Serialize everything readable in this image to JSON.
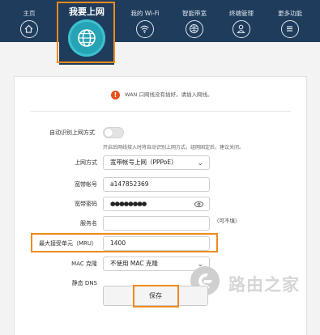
{
  "nav": {
    "items": [
      {
        "label": "主页",
        "icon": "home-icon"
      },
      {
        "label": "我的 Wi-Fi",
        "icon": "wifi-icon"
      },
      {
        "label": "智能带宽",
        "icon": "bandwidth-icon"
      },
      {
        "label": "终端管理",
        "icon": "user-icon"
      },
      {
        "label": "更多功能",
        "icon": "menu-icon"
      }
    ],
    "active": {
      "label": "我要上网",
      "icon": "globe-icon"
    }
  },
  "warning": {
    "text": "WAN 口网线没有插好，请插入网线。",
    "icon": "warning-icon"
  },
  "form": {
    "auto_detect_label": "自动识别上网方式",
    "auto_detect_hint": "开启后网线接入时将自动识别上网方式，组网固定后，建议关闭。",
    "wan_type_label": "上网方式",
    "wan_type_value": "宽带帐号上网（PPPoE）",
    "account_label": "宽带帐号",
    "account_value": "a147852369",
    "password_label": "宽带密码",
    "password_value": "●●●●●●●●",
    "service_label": "服务名",
    "service_value": "",
    "service_note": "（可不填）",
    "mru_label": "最大接受单元（MRU）",
    "mru_value": "1400",
    "mac_label": "MAC 克隆",
    "mac_value": "不使用 MAC 克隆",
    "dns_label": "静态 DNS"
  },
  "save_label": "保存",
  "watermark_text": "路由之家",
  "colors": {
    "nav_bg": "#1f3c5c",
    "accent": "#27a3b6",
    "highlight": "#f08a1c",
    "warning": "#e8501e"
  }
}
